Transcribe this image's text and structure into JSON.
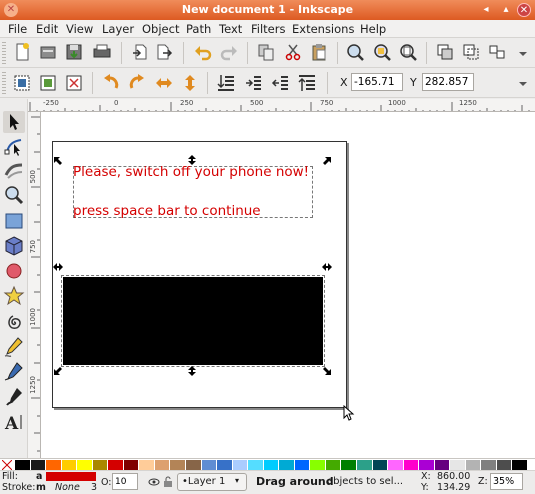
{
  "window": {
    "title": "New document 1 - Inkscape"
  },
  "menu": [
    "File",
    "Edit",
    "View",
    "Layer",
    "Object",
    "Path",
    "Text",
    "Filters",
    "Extensions",
    "Help"
  ],
  "toolbar": {
    "x_label": "X",
    "x_value": "-165.71",
    "y_label": "Y",
    "y_value": "282.857"
  },
  "hruler": {
    "ticks": [
      "-250",
      "0",
      "250",
      "500",
      "750",
      "1000",
      "1250"
    ]
  },
  "vruler": {
    "ticks": [
      "500",
      "750",
      "1000",
      "1250"
    ]
  },
  "canvas": {
    "line1": "Please, switch off your phone now!",
    "line2": "press space bar to continue"
  },
  "colors": {
    "text": "#d40000",
    "accent": "#e05a24"
  },
  "palette": [
    "#000000",
    "#1a1a1a",
    "#ff6600",
    "#ffcc00",
    "#ffff00",
    "#aa8800",
    "#d40000",
    "#800000",
    "#ffcc99",
    "#dda06f",
    "#b38457",
    "#876548",
    "#5f8dd3",
    "#3771c8",
    "#aaccff",
    "#55ddff",
    "#00ccff",
    "#00aad4",
    "#0066ff",
    "#88ff00",
    "#44aa00",
    "#008000",
    "#2ca089",
    "#004455",
    "#ff66ff",
    "#ff00cc",
    "#aa00d4",
    "#660080",
    "#e6e6e6",
    "#b3b3b3",
    "#808080",
    "#4d4d4d",
    "#000000"
  ],
  "status": {
    "fill_label": "Fill:",
    "fill_value": "a",
    "stroke_label": "Stroke:",
    "stroke_value": "m",
    "stroke_none": "None",
    "stroke_width": "3",
    "opacity_label": "O:",
    "opacity_value": "10",
    "layer": "•Layer 1",
    "msg_bold": "Drag around",
    "msg_rest": " objects to sel...",
    "x_label": "X:",
    "x_value": "860.00",
    "y_label": "Y:",
    "y_value": "134.29",
    "zoom_label": "Z:",
    "zoom_value": "35%"
  }
}
